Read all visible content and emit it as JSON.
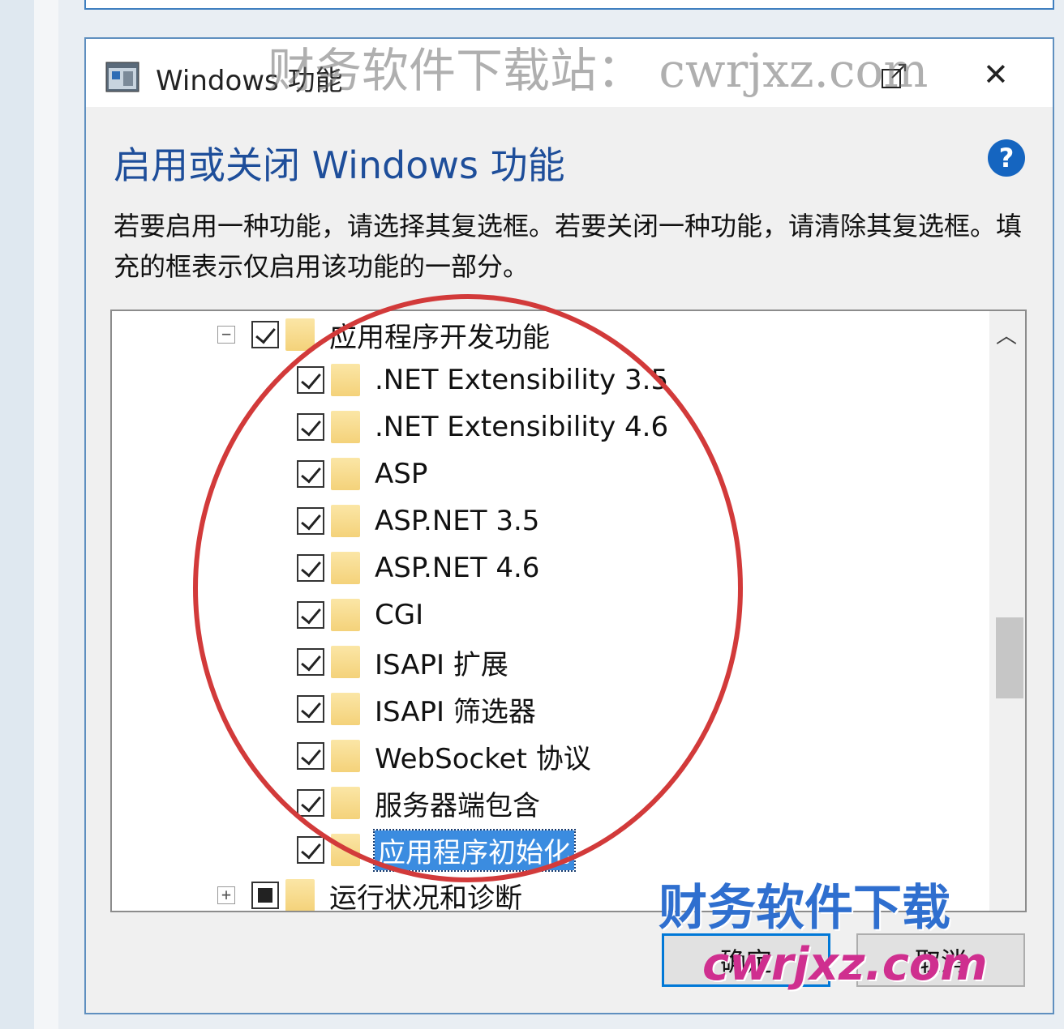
{
  "window": {
    "title": "Windows 功能",
    "restore_icon": "restore-icon",
    "close_label": "✕"
  },
  "header": {
    "heading": "启用或关闭 Windows 功能",
    "help_label": "?",
    "description": "若要启用一种功能，请选择其复选框。若要关闭一种功能，请清除其复选框。填充的框表示仅启用该功能的一部分。"
  },
  "tree": {
    "items": [
      {
        "label": "应用程序开发功能",
        "level": 1,
        "expander": "−",
        "state": "checked"
      },
      {
        "label": ".NET Extensibility 3.5",
        "level": 2,
        "state": "checked"
      },
      {
        "label": ".NET Extensibility 4.6",
        "level": 2,
        "state": "checked"
      },
      {
        "label": "ASP",
        "level": 2,
        "state": "checked"
      },
      {
        "label": "ASP.NET 3.5",
        "level": 2,
        "state": "checked"
      },
      {
        "label": "ASP.NET 4.6",
        "level": 2,
        "state": "checked"
      },
      {
        "label": "CGI",
        "level": 2,
        "state": "checked"
      },
      {
        "label": "ISAPI 扩展",
        "level": 2,
        "state": "checked"
      },
      {
        "label": "ISAPI 筛选器",
        "level": 2,
        "state": "checked"
      },
      {
        "label": "WebSocket 协议",
        "level": 2,
        "state": "checked"
      },
      {
        "label": "服务器端包含",
        "level": 2,
        "state": "checked"
      },
      {
        "label": "应用程序初始化",
        "level": 2,
        "state": "checked",
        "selected": true
      },
      {
        "label": "运行状况和诊断",
        "level": 1,
        "expander": "+",
        "state": "partial"
      }
    ]
  },
  "buttons": {
    "ok": "确定",
    "cancel": "取消"
  },
  "watermarks": {
    "top": "财务软件下载站： cwrjxz.com",
    "bottom_cn": "财务软件下载",
    "bottom_url": "cwrjxz.com"
  },
  "colors": {
    "heading": "#1e4e9a",
    "accent": "#0078d7",
    "selection": "#3b8ce0",
    "annotation_circle": "#d23a3a"
  }
}
